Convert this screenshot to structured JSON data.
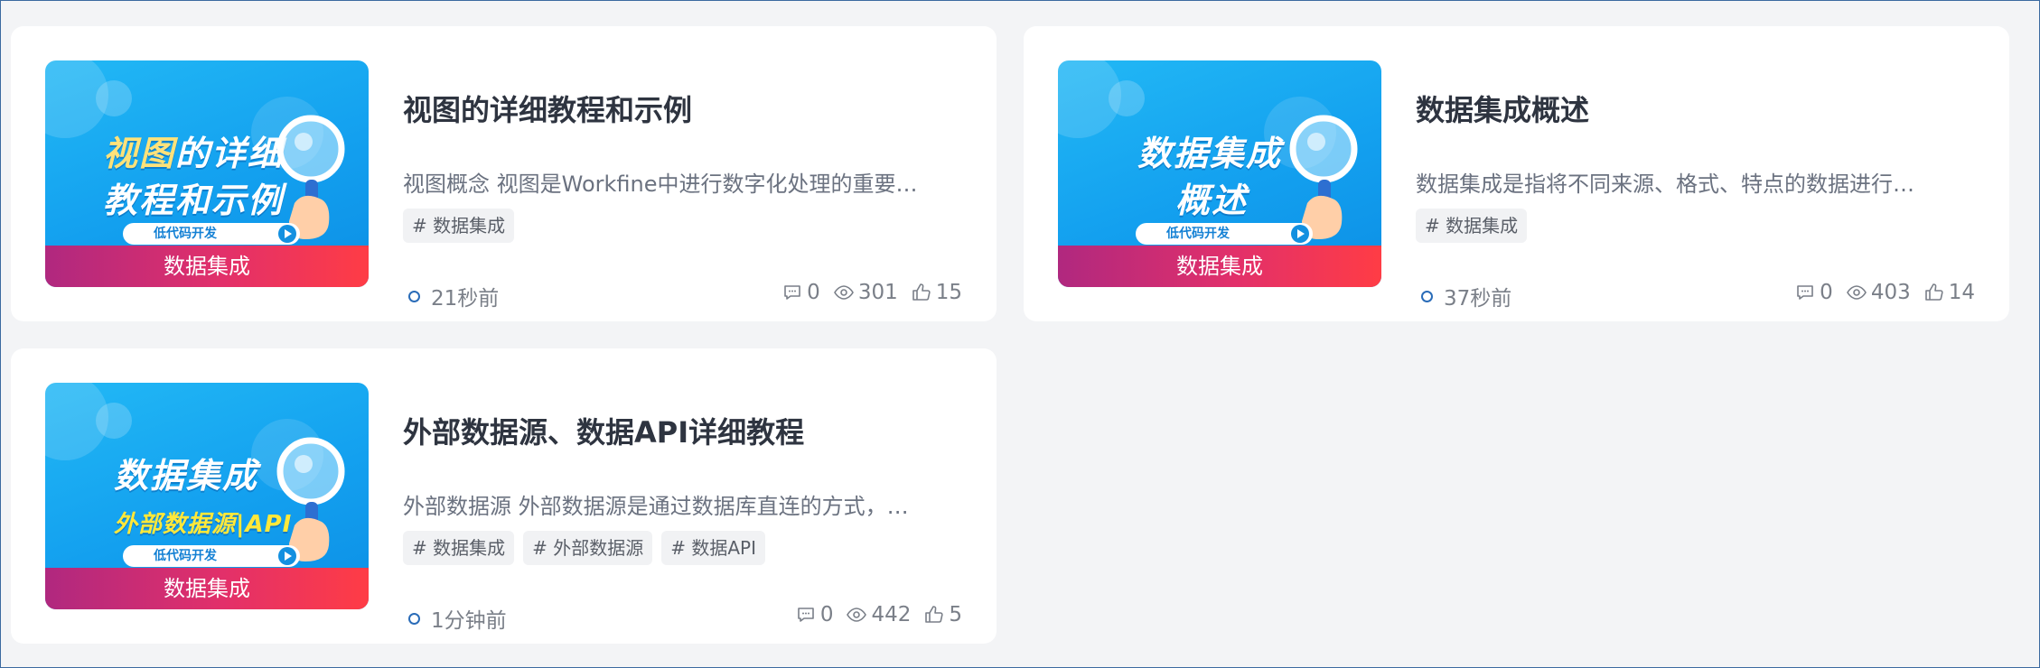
{
  "cards": [
    {
      "thumb": {
        "line1_hl": "视图",
        "line1_rest": "的详细",
        "line2": "教程和示例",
        "pill": "低代码开发",
        "band": "数据集成"
      },
      "title": "视图的详细教程和示例",
      "desc": "视图概念 视图是Workfine中进行数字化处理的重要…",
      "tags": [
        "# 数据集成"
      ],
      "time": "21秒前",
      "comments": "0",
      "views": "301",
      "likes": "15"
    },
    {
      "thumb": {
        "line1_hl": "",
        "line1_rest": "数据集成",
        "line2": "概述",
        "pill": "低代码开发",
        "band": "数据集成"
      },
      "title": "数据集成概述",
      "desc": "数据集成是指将不同来源、格式、特点的数据进行…",
      "tags": [
        "# 数据集成"
      ],
      "time": "37秒前",
      "comments": "0",
      "views": "403",
      "likes": "14"
    },
    {
      "thumb": {
        "line1_hl": "",
        "line1_rest": "数据集成",
        "line2": "外部数据源|API",
        "pill": "低代码开发",
        "band": "数据集成"
      },
      "title": "外部数据源、数据API详细教程",
      "desc": "外部数据源 外部数据源是通过数据库直连的方式，…",
      "tags": [
        "# 数据集成",
        "# 外部数据源",
        "# 数据API"
      ],
      "time": "1分钟前",
      "comments": "0",
      "views": "442",
      "likes": "5"
    }
  ]
}
